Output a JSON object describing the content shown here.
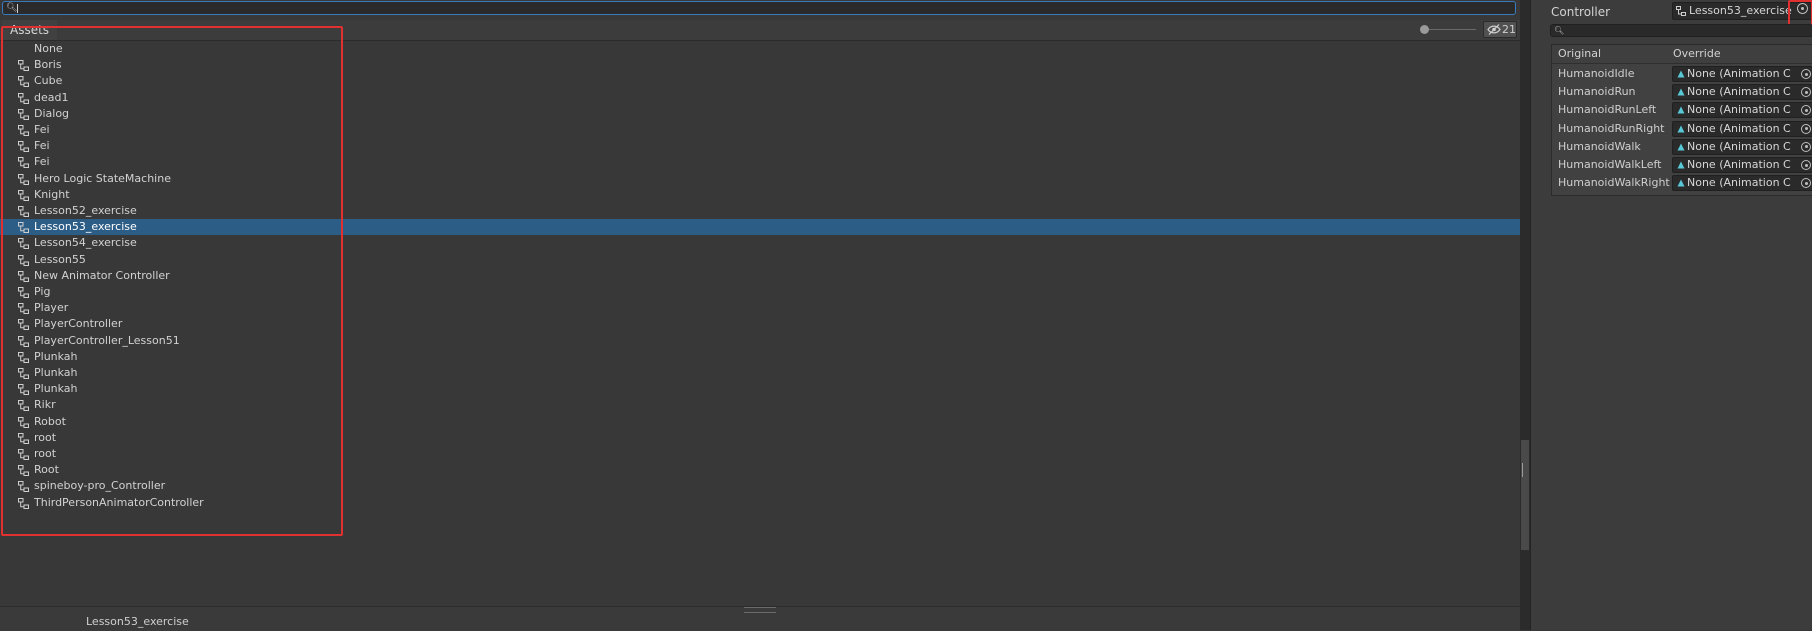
{
  "picker": {
    "search": {
      "value": ""
    },
    "tab_label": "Assets",
    "hidden_count": "21",
    "items": [
      {
        "label": "None",
        "icon": "none"
      },
      {
        "label": "Boris",
        "icon": "animator-controller-icon"
      },
      {
        "label": "Cube",
        "icon": "animator-controller-icon"
      },
      {
        "label": "dead1",
        "icon": "animator-controller-icon"
      },
      {
        "label": "Dialog",
        "icon": "animator-controller-icon"
      },
      {
        "label": "Fei",
        "icon": "animator-controller-icon"
      },
      {
        "label": "Fei",
        "icon": "animator-controller-icon"
      },
      {
        "label": "Fei",
        "icon": "animator-controller-icon"
      },
      {
        "label": "Hero Logic StateMachine",
        "icon": "animator-controller-icon"
      },
      {
        "label": "Knight",
        "icon": "animator-controller-icon"
      },
      {
        "label": "Lesson52_exercise",
        "icon": "animator-controller-icon"
      },
      {
        "label": "Lesson53_exercise",
        "icon": "animator-controller-icon",
        "selected": true
      },
      {
        "label": "Lesson54_exercise",
        "icon": "animator-controller-icon"
      },
      {
        "label": "Lesson55",
        "icon": "animator-controller-icon"
      },
      {
        "label": "New Animator Controller",
        "icon": "animator-controller-icon"
      },
      {
        "label": "Pig",
        "icon": "animator-controller-icon"
      },
      {
        "label": "Player",
        "icon": "animator-controller-icon"
      },
      {
        "label": "PlayerController",
        "icon": "animator-controller-icon"
      },
      {
        "label": "PlayerController_Lesson51",
        "icon": "animator-controller-icon"
      },
      {
        "label": "Plunkah",
        "icon": "animator-controller-icon"
      },
      {
        "label": "Plunkah",
        "icon": "animator-controller-icon"
      },
      {
        "label": "Plunkah",
        "icon": "animator-controller-icon"
      },
      {
        "label": "Rikr",
        "icon": "animator-controller-icon"
      },
      {
        "label": "Robot",
        "icon": "animator-controller-icon"
      },
      {
        "label": "root",
        "icon": "animator-controller-icon"
      },
      {
        "label": "root",
        "icon": "animator-controller-icon"
      },
      {
        "label": "Root",
        "icon": "animator-controller-icon"
      },
      {
        "label": "spineboy-pro_Controller",
        "icon": "animator-controller-icon"
      },
      {
        "label": "ThirdPersonAnimatorController",
        "icon": "animator-controller-icon"
      }
    ],
    "status_selected": "Lesson53_exercise"
  },
  "inspector": {
    "controller_label": "Controller",
    "controller_value": "Lesson53_exercise",
    "search": {
      "value": ""
    },
    "columns": {
      "original": "Original",
      "override": "Override"
    },
    "clips": [
      {
        "original": "HumanoidIdle",
        "override": "None (Animation C"
      },
      {
        "original": "HumanoidRun",
        "override": "None (Animation C"
      },
      {
        "original": "HumanoidRunLeft",
        "override": "None (Animation C"
      },
      {
        "original": "HumanoidRunRight",
        "override": "None (Animation C"
      },
      {
        "original": "HumanoidWalk",
        "override": "None (Animation C"
      },
      {
        "original": "HumanoidWalkLeft",
        "override": "None (Animation C"
      },
      {
        "original": "HumanoidWalkRight",
        "override": "None (Animation C"
      }
    ]
  },
  "colors": {
    "selection": "#2c5d87",
    "highlight_box": "#e03030",
    "search_focus": "#3a79bb",
    "animation_clip_icon": "#59c8d6"
  }
}
